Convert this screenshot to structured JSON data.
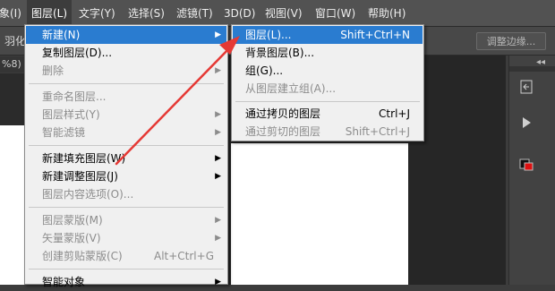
{
  "menubar": {
    "items": [
      {
        "label": "象(I)"
      },
      {
        "label": "图层(L)"
      },
      {
        "label": "文字(Y)"
      },
      {
        "label": "选择(S)"
      },
      {
        "label": "滤镜(T)"
      },
      {
        "label": "3D(D)"
      },
      {
        "label": "视图(V)"
      },
      {
        "label": "窗口(W)"
      },
      {
        "label": "帮助(H)"
      }
    ]
  },
  "options_bar": {
    "feather_label": "羽化",
    "adjust_edge_label": "调整边缘..."
  },
  "doc_tab": {
    "label": "%8)"
  },
  "layer_menu": {
    "items": [
      {
        "label": "新建(N)",
        "enabled": true,
        "highlighted": true,
        "submenu": true
      },
      {
        "label": "复制图层(D)...",
        "enabled": true
      },
      {
        "label": "删除",
        "enabled": false,
        "submenu": true
      },
      {
        "label": "重命名图层...",
        "enabled": false
      },
      {
        "label": "图层样式(Y)",
        "enabled": false,
        "submenu": true
      },
      {
        "label": "智能滤镜",
        "enabled": false,
        "submenu": true
      },
      {
        "label": "新建填充图层(W)",
        "enabled": true,
        "submenu": true
      },
      {
        "label": "新建调整图层(J)",
        "enabled": true,
        "submenu": true
      },
      {
        "label": "图层内容选项(O)...",
        "enabled": false
      },
      {
        "label": "图层蒙版(M)",
        "enabled": false,
        "submenu": true
      },
      {
        "label": "矢量蒙版(V)",
        "enabled": false,
        "submenu": true
      },
      {
        "label": "创建剪贴蒙版(C)",
        "enabled": false,
        "shortcut": "Alt+Ctrl+G"
      },
      {
        "label": "智能对象",
        "enabled": true,
        "submenu": true
      }
    ]
  },
  "new_submenu": {
    "items": [
      {
        "label": "图层(L)...",
        "shortcut": "Shift+Ctrl+N",
        "enabled": true,
        "highlighted": true
      },
      {
        "label": "背景图层(B)...",
        "enabled": true
      },
      {
        "label": "组(G)...",
        "enabled": true
      },
      {
        "label": "从图层建立组(A)...",
        "enabled": false
      },
      {
        "label": "通过拷贝的图层",
        "shortcut": "Ctrl+J",
        "enabled": true
      },
      {
        "label": "通过剪切的图层",
        "shortcut": "Shift+Ctrl+J",
        "enabled": false
      }
    ]
  },
  "annotation": {
    "color": "#e53935"
  },
  "colors": {
    "menu_bg": "#f0f0f0",
    "highlight": "#2a7cd0",
    "app_bg": "#3c3c3c"
  }
}
